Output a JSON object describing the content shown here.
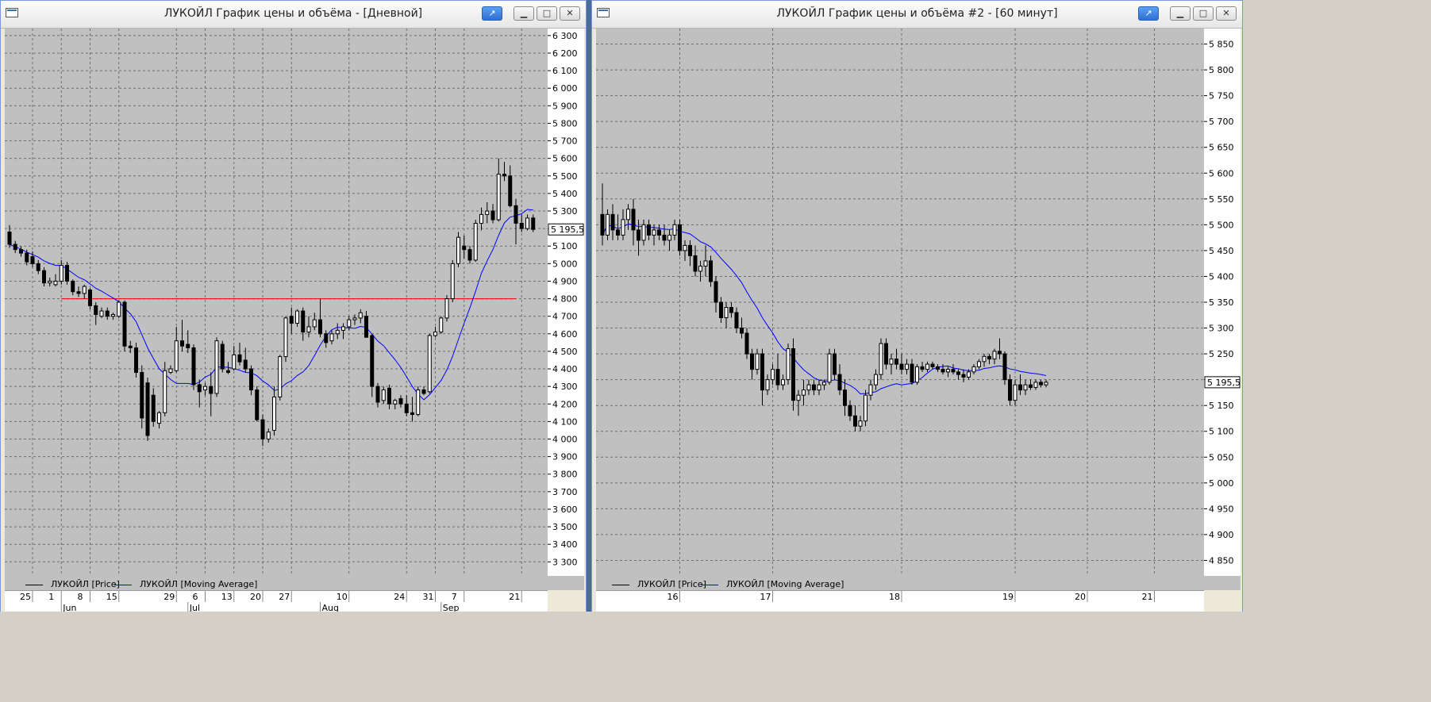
{
  "windows": [
    {
      "id": "w1",
      "title": "ЛУКОЙЛ График цены и объёма - [Дневной]",
      "legend": [
        {
          "label": "ЛУКОЙЛ [Price]",
          "color": "#000000"
        },
        {
          "label": "ЛУКОЙЛ [Moving Average]",
          "color": "#0000ff"
        }
      ],
      "last_price_label": "5 195,5"
    },
    {
      "id": "w2",
      "title": "ЛУКОЙЛ График цены и объёма #2 - [60 минут]",
      "legend": [
        {
          "label": "ЛУКОЙЛ [Price]",
          "color": "#000000"
        },
        {
          "label": "ЛУКОЙЛ [Moving Average]",
          "color": "#0000ff"
        }
      ],
      "last_price_label": "5 195,5"
    }
  ],
  "chart_data": [
    {
      "type": "candlestick",
      "timeframe": "Дневной",
      "ylim": [
        3220,
        6340
      ],
      "y_ticks": [
        3300,
        3400,
        3500,
        3600,
        3700,
        3800,
        3900,
        4000,
        4100,
        4200,
        4300,
        4400,
        4500,
        4600,
        4700,
        4800,
        4900,
        5000,
        5100,
        5200,
        5300,
        5400,
        5500,
        5600,
        5700,
        5800,
        5900,
        6000,
        6100,
        6200,
        6300
      ],
      "y_tick_labels": [
        "3 300",
        "3 400",
        "3 500",
        "3 600",
        "3 700",
        "3 800",
        "3 900",
        "4 000",
        "4 100",
        "4 200",
        "4 300",
        "4 400",
        "4 500",
        "4 600",
        "4 700",
        "4 800",
        "4 900",
        "5 000",
        "5 100",
        "5 200",
        "5 300",
        "5 400",
        "5 500",
        "5 600",
        "5 700",
        "5 800",
        "5 900",
        "6 000",
        "6 100",
        "6 200",
        "6 300"
      ],
      "x_tick_labels": [
        {
          "label": "25",
          "index": 4
        },
        {
          "label": "1",
          "index": 9
        },
        {
          "label": "8",
          "index": 14
        },
        {
          "label": "15",
          "index": 19
        },
        {
          "label": "29",
          "index": 29
        },
        {
          "label": "6",
          "index": 34
        },
        {
          "label": "13",
          "index": 39
        },
        {
          "label": "20",
          "index": 44
        },
        {
          "label": "27",
          "index": 49
        },
        {
          "label": "10",
          "index": 59
        },
        {
          "label": "24",
          "index": 69
        },
        {
          "label": "31",
          "index": 74
        },
        {
          "label": "7",
          "index": 79
        },
        {
          "label": "21",
          "index": 89
        }
      ],
      "month_labels": [
        {
          "label": "Jun",
          "index": 9
        },
        {
          "label": "Jul",
          "index": 31
        },
        {
          "label": "Aug",
          "index": 54
        },
        {
          "label": "Sep",
          "index": 75
        }
      ],
      "hline": {
        "value": 4800,
        "color": "#ff0000",
        "from_index": 9,
        "to_index": 88
      },
      "candles": [
        [
          5180,
          5220,
          5090,
          5110
        ],
        [
          5110,
          5130,
          5060,
          5080
        ],
        [
          5080,
          5100,
          5040,
          5060
        ],
        [
          5060,
          5080,
          4990,
          5010
        ],
        [
          5040,
          5070,
          4980,
          5000
        ],
        [
          5000,
          5020,
          4940,
          4960
        ],
        [
          4960,
          4980,
          4870,
          4890
        ],
        [
          4890,
          4920,
          4870,
          4900
        ],
        [
          4880,
          4940,
          4870,
          4900
        ],
        [
          4900,
          5020,
          4880,
          4990
        ],
        [
          4990,
          5010,
          4880,
          4900
        ],
        [
          4900,
          4910,
          4820,
          4840
        ],
        [
          4840,
          4870,
          4810,
          4830
        ],
        [
          4830,
          4880,
          4800,
          4870
        ],
        [
          4850,
          4860,
          4740,
          4760
        ],
        [
          4760,
          4780,
          4650,
          4710
        ],
        [
          4700,
          4750,
          4690,
          4730
        ],
        [
          4730,
          4750,
          4680,
          4700
        ],
        [
          4700,
          4720,
          4680,
          4710
        ],
        [
          4700,
          4790,
          4690,
          4780
        ],
        [
          4780,
          4790,
          4500,
          4530
        ],
        [
          4530,
          4560,
          4490,
          4520
        ],
        [
          4520,
          4550,
          4350,
          4380
        ],
        [
          4380,
          4420,
          4060,
          4120
        ],
        [
          4320,
          4350,
          3990,
          4020
        ],
        [
          4250,
          4290,
          4070,
          4100
        ],
        [
          4090,
          4160,
          4060,
          4150
        ],
        [
          4150,
          4440,
          4130,
          4390
        ],
        [
          4380,
          4420,
          4370,
          4400
        ],
        [
          4390,
          4640,
          4380,
          4560
        ],
        [
          4560,
          4680,
          4500,
          4530
        ],
        [
          4540,
          4620,
          4490,
          4520
        ],
        [
          4520,
          4540,
          4280,
          4310
        ],
        [
          4310,
          4340,
          4180,
          4270
        ],
        [
          4280,
          4320,
          4250,
          4300
        ],
        [
          4300,
          4380,
          4130,
          4260
        ],
        [
          4260,
          4580,
          4240,
          4560
        ],
        [
          4540,
          4560,
          4380,
          4400
        ],
        [
          4390,
          4440,
          4370,
          4380
        ],
        [
          4400,
          4530,
          4390,
          4480
        ],
        [
          4480,
          4550,
          4420,
          4440
        ],
        [
          4450,
          4520,
          4380,
          4400
        ],
        [
          4400,
          4420,
          4250,
          4280
        ],
        [
          4280,
          4300,
          4100,
          4110
        ],
        [
          4110,
          4140,
          3960,
          4000
        ],
        [
          4000,
          4060,
          3980,
          4040
        ],
        [
          4050,
          4300,
          4020,
          4240
        ],
        [
          4240,
          4480,
          4220,
          4470
        ],
        [
          4470,
          4700,
          4440,
          4690
        ],
        [
          4700,
          4750,
          4600,
          4660
        ],
        [
          4660,
          4740,
          4640,
          4730
        ],
        [
          4730,
          4750,
          4560,
          4610
        ],
        [
          4610,
          4700,
          4580,
          4640
        ],
        [
          4640,
          4720,
          4620,
          4680
        ],
        [
          4680,
          4800,
          4580,
          4600
        ],
        [
          4600,
          4620,
          4520,
          4550
        ],
        [
          4560,
          4620,
          4540,
          4600
        ],
        [
          4600,
          4660,
          4570,
          4620
        ],
        [
          4620,
          4660,
          4570,
          4640
        ],
        [
          4640,
          4700,
          4620,
          4680
        ],
        [
          4680,
          4710,
          4650,
          4690
        ],
        [
          4690,
          4740,
          4660,
          4720
        ],
        [
          4700,
          4730,
          4580,
          4580
        ],
        [
          4590,
          4600,
          4240,
          4300
        ],
        [
          4300,
          4320,
          4180,
          4210
        ],
        [
          4220,
          4300,
          4200,
          4280
        ],
        [
          4290,
          4310,
          4170,
          4200
        ],
        [
          4200,
          4230,
          4170,
          4220
        ],
        [
          4230,
          4250,
          4180,
          4200
        ],
        [
          4200,
          4250,
          4130,
          4150
        ],
        [
          4150,
          4240,
          4100,
          4140
        ],
        [
          4140,
          4300,
          4130,
          4280
        ],
        [
          4280,
          4300,
          4250,
          4260
        ],
        [
          4270,
          4600,
          4260,
          4590
        ],
        [
          4590,
          4640,
          4580,
          4610
        ],
        [
          4610,
          4700,
          4600,
          4690
        ],
        [
          4690,
          4820,
          4670,
          4800
        ],
        [
          4800,
          5020,
          4780,
          5000
        ],
        [
          5000,
          5180,
          4980,
          5150
        ],
        [
          5100,
          5160,
          5030,
          5080
        ],
        [
          5080,
          5100,
          5000,
          5020
        ],
        [
          5020,
          5250,
          5010,
          5230
        ],
        [
          5230,
          5320,
          5190,
          5280
        ],
        [
          5280,
          5350,
          5230,
          5300
        ],
        [
          5300,
          5340,
          5230,
          5250
        ],
        [
          5250,
          5600,
          5240,
          5510
        ],
        [
          5510,
          5580,
          5470,
          5500
        ],
        [
          5500,
          5560,
          5320,
          5330
        ],
        [
          5330,
          5370,
          5110,
          5230
        ],
        [
          5230,
          5280,
          5180,
          5200
        ],
        [
          5200,
          5280,
          5190,
          5260
        ],
        [
          5260,
          5280,
          5180,
          5195
        ]
      ],
      "ma_period": 10
    },
    {
      "type": "candlestick",
      "timeframe": "60 минут",
      "ylim": [
        4820,
        5880
      ],
      "y_ticks": [
        4850,
        4900,
        4950,
        5000,
        5050,
        5100,
        5150,
        5200,
        5250,
        5300,
        5350,
        5400,
        5450,
        5500,
        5550,
        5600,
        5650,
        5700,
        5750,
        5800,
        5850
      ],
      "y_tick_labels": [
        "4 850",
        "4 900",
        "4 950",
        "5 000",
        "5 050",
        "5 100",
        "5 150",
        "5 200",
        "5 250",
        "5 300",
        "5 350",
        "5 400",
        "5 450",
        "5 500",
        "5 550",
        "5 600",
        "5 650",
        "5 700",
        "5 750",
        "5 800",
        "5 850"
      ],
      "x_tick_labels": [
        {
          "label": "16",
          "index": 15
        },
        {
          "label": "17",
          "index": 33
        },
        {
          "label": "18",
          "index": 58
        },
        {
          "label": "19",
          "index": 80
        },
        {
          "label": "20",
          "index": 94
        },
        {
          "label": "21",
          "index": 107
        }
      ],
      "month_labels": [],
      "candles": [
        [
          5520,
          5580,
          5460,
          5480
        ],
        [
          5480,
          5530,
          5470,
          5520
        ],
        [
          5520,
          5540,
          5470,
          5490
        ],
        [
          5490,
          5520,
          5470,
          5480
        ],
        [
          5480,
          5530,
          5470,
          5510
        ],
        [
          5510,
          5540,
          5490,
          5530
        ],
        [
          5530,
          5550,
          5460,
          5490
        ],
        [
          5490,
          5510,
          5440,
          5470
        ],
        [
          5470,
          5510,
          5460,
          5500
        ],
        [
          5500,
          5510,
          5470,
          5480
        ],
        [
          5480,
          5500,
          5460,
          5490
        ],
        [
          5490,
          5500,
          5470,
          5480
        ],
        [
          5480,
          5500,
          5460,
          5470
        ],
        [
          5470,
          5490,
          5450,
          5480
        ],
        [
          5480,
          5510,
          5470,
          5500
        ],
        [
          5500,
          5510,
          5440,
          5450
        ],
        [
          5450,
          5470,
          5430,
          5460
        ],
        [
          5460,
          5470,
          5420,
          5440
        ],
        [
          5440,
          5460,
          5400,
          5410
        ],
        [
          5410,
          5430,
          5390,
          5420
        ],
        [
          5420,
          5460,
          5400,
          5430
        ],
        [
          5430,
          5440,
          5380,
          5390
        ],
        [
          5390,
          5400,
          5330,
          5350
        ],
        [
          5350,
          5360,
          5310,
          5320
        ],
        [
          5320,
          5350,
          5300,
          5340
        ],
        [
          5340,
          5350,
          5320,
          5330
        ],
        [
          5330,
          5340,
          5290,
          5300
        ],
        [
          5300,
          5320,
          5280,
          5290
        ],
        [
          5290,
          5300,
          5240,
          5250
        ],
        [
          5250,
          5260,
          5200,
          5220
        ],
        [
          5220,
          5260,
          5210,
          5250
        ],
        [
          5250,
          5260,
          5150,
          5180
        ],
        [
          5180,
          5210,
          5170,
          5200
        ],
        [
          5200,
          5230,
          5190,
          5220
        ],
        [
          5220,
          5250,
          5180,
          5190
        ],
        [
          5190,
          5210,
          5180,
          5200
        ],
        [
          5200,
          5270,
          5190,
          5260
        ],
        [
          5260,
          5280,
          5140,
          5160
        ],
        [
          5160,
          5180,
          5130,
          5170
        ],
        [
          5170,
          5200,
          5150,
          5180
        ],
        [
          5180,
          5200,
          5170,
          5190
        ],
        [
          5190,
          5200,
          5170,
          5180
        ],
        [
          5180,
          5200,
          5170,
          5190
        ],
        [
          5190,
          5200,
          5180,
          5195
        ],
        [
          5195,
          5260,
          5190,
          5250
        ],
        [
          5250,
          5260,
          5200,
          5210
        ],
        [
          5210,
          5230,
          5170,
          5180
        ],
        [
          5180,
          5200,
          5130,
          5150
        ],
        [
          5150,
          5160,
          5120,
          5130
        ],
        [
          5130,
          5150,
          5100,
          5110
        ],
        [
          5110,
          5130,
          5100,
          5120
        ],
        [
          5120,
          5180,
          5110,
          5170
        ],
        [
          5170,
          5200,
          5160,
          5190
        ],
        [
          5190,
          5220,
          5180,
          5210
        ],
        [
          5210,
          5280,
          5200,
          5270
        ],
        [
          5270,
          5280,
          5220,
          5230
        ],
        [
          5230,
          5250,
          5210,
          5240
        ],
        [
          5240,
          5260,
          5220,
          5230
        ],
        [
          5230,
          5250,
          5210,
          5220
        ],
        [
          5220,
          5240,
          5210,
          5230
        ],
        [
          5230,
          5240,
          5190,
          5195
        ],
        [
          5195,
          5230,
          5190,
          5225
        ],
        [
          5225,
          5235,
          5215,
          5220
        ],
        [
          5220,
          5235,
          5215,
          5230
        ],
        [
          5230,
          5235,
          5220,
          5225
        ],
        [
          5225,
          5230,
          5215,
          5220
        ],
        [
          5220,
          5230,
          5210,
          5215
        ],
        [
          5215,
          5225,
          5205,
          5220
        ],
        [
          5220,
          5230,
          5210,
          5215
        ],
        [
          5215,
          5220,
          5200,
          5210
        ],
        [
          5210,
          5220,
          5195,
          5205
        ],
        [
          5205,
          5220,
          5200,
          5215
        ],
        [
          5215,
          5230,
          5210,
          5225
        ],
        [
          5225,
          5240,
          5220,
          5235
        ],
        [
          5235,
          5250,
          5225,
          5245
        ],
        [
          5245,
          5250,
          5230,
          5240
        ],
        [
          5240,
          5260,
          5230,
          5255
        ],
        [
          5255,
          5280,
          5240,
          5250
        ],
        [
          5250,
          5255,
          5190,
          5200
        ],
        [
          5200,
          5210,
          5150,
          5160
        ],
        [
          5160,
          5200,
          5150,
          5190
        ],
        [
          5190,
          5210,
          5170,
          5180
        ],
        [
          5180,
          5200,
          5170,
          5190
        ],
        [
          5190,
          5200,
          5180,
          5185
        ],
        [
          5185,
          5200,
          5180,
          5195
        ],
        [
          5195,
          5200,
          5185,
          5190
        ],
        [
          5190,
          5200,
          5185,
          5195
        ]
      ],
      "ma_period": 14
    }
  ]
}
